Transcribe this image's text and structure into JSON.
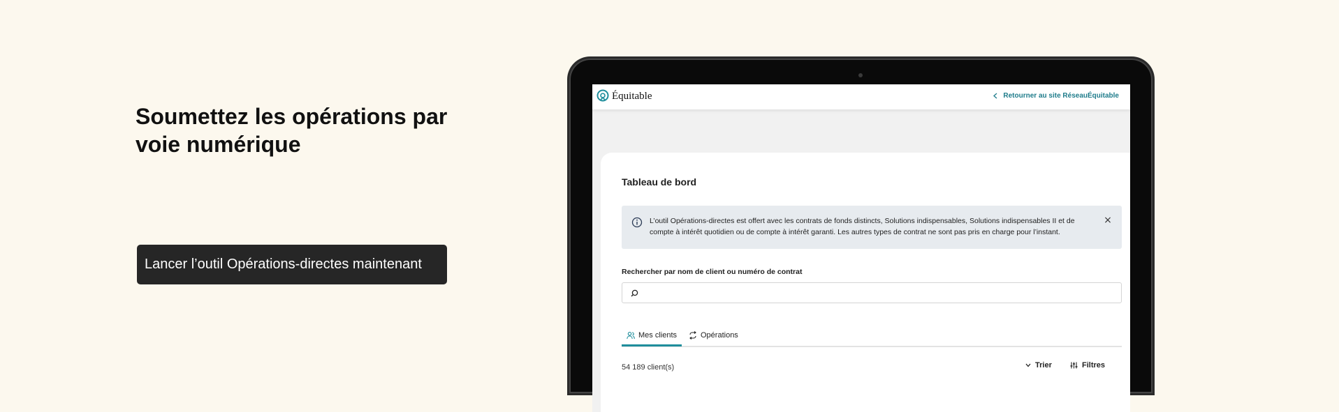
{
  "hero": {
    "title": "Soumettez les opérations par voie numérique",
    "cta_label": "Lancer l’outil Opérations-directes maintenant"
  },
  "app": {
    "logo_text": "Équitable",
    "back_link": "Retourner au site RéseauÉquitable",
    "page_title": "Tableau de bord",
    "notice": "L’outil Opérations-directes est offert avec les contrats de fonds distincts, Solutions indispensables, Solutions indispensables II et de compte à intérêt quotidien ou de compte à intérêt garanti. Les autres types de contrat ne sont pas pris en charge pour l’instant.",
    "notice_close": "×",
    "search_label": "Rechercher par nom de client ou numéro de contrat",
    "search_value": "",
    "tabs": [
      {
        "label": "Mes clients",
        "icon": "users-icon"
      },
      {
        "label": "Opérations",
        "icon": "exchange-icon"
      }
    ],
    "client_count": "54 189 client(s)",
    "sort_label": "Trier",
    "filter_label": "Filtres"
  },
  "colors": {
    "page_bg": "#fcf8ee",
    "button_bg": "#262626",
    "accent": "#1f8e9c",
    "link": "#1f7c8b",
    "notice_bg": "#e7ebef"
  }
}
